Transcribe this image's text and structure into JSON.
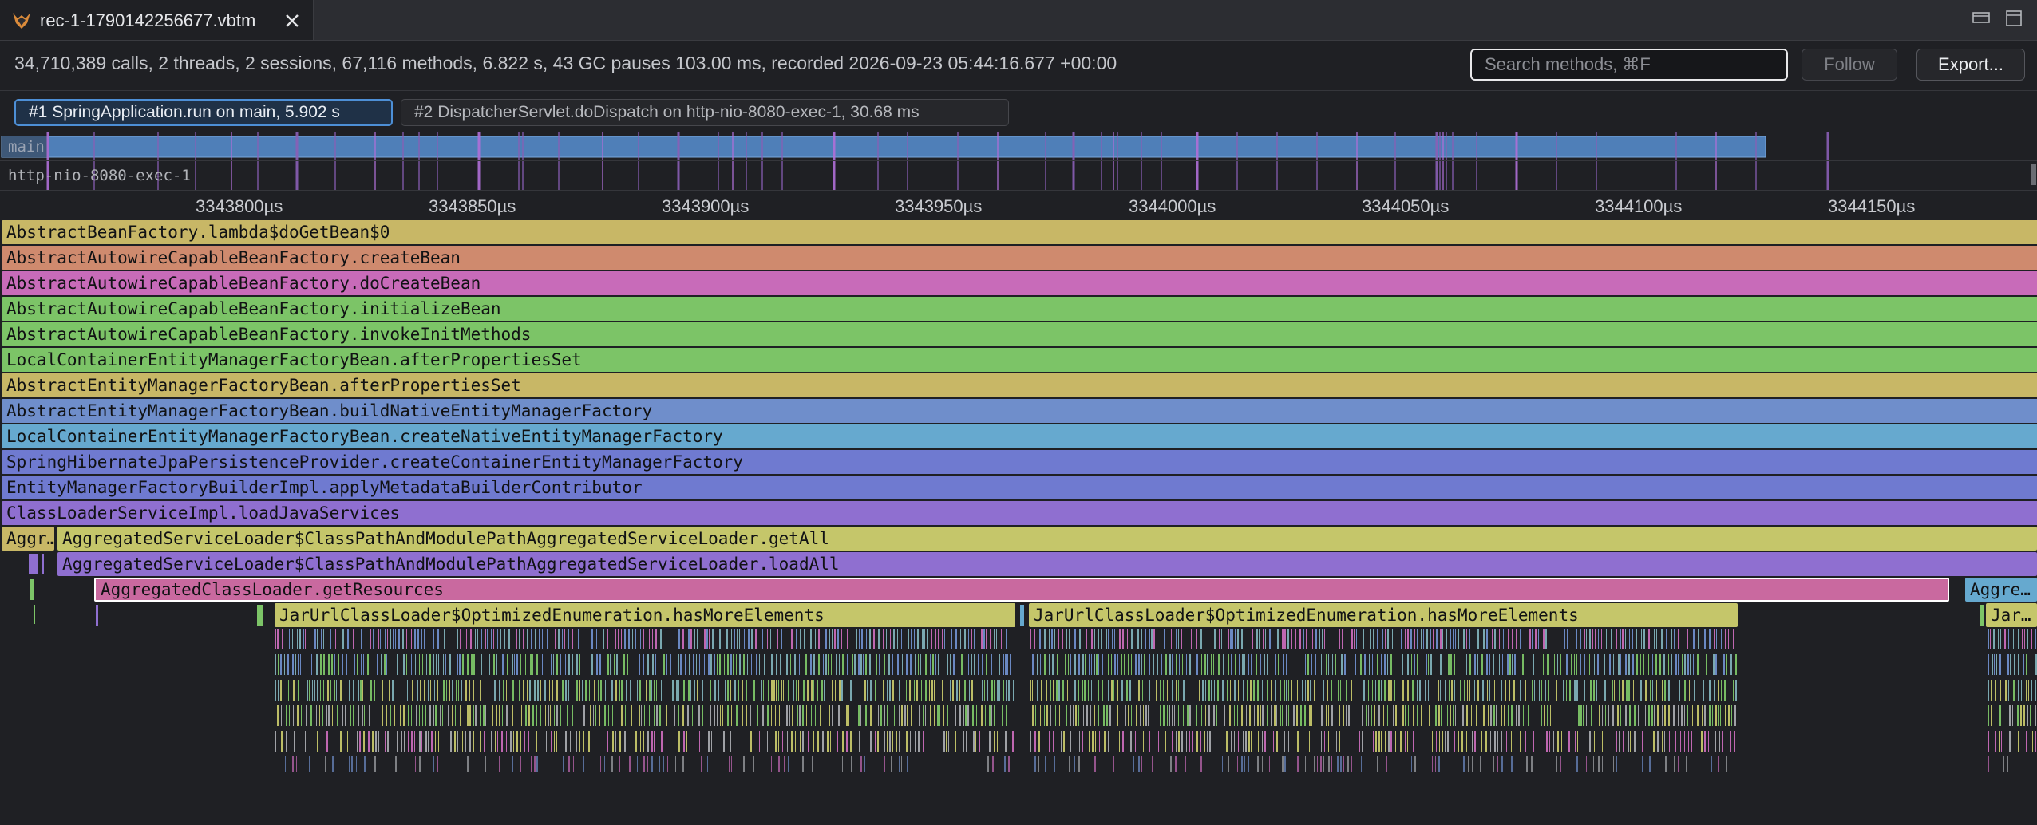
{
  "tab": {
    "title": "rec-1-1790142256677.vbtm",
    "close_icon": "close-icon",
    "logo_icon": "fox-logo-icon"
  },
  "window_controls": [
    "minimize-icon",
    "maximize-icon"
  ],
  "summary": {
    "text": "34,710,389 calls, 2 threads, 2 sessions, 67,116 methods, 6.822 s, 43 GC pauses 103.00 ms, recorded 2026-09-23 05:44:16.677 +00:00"
  },
  "search": {
    "placeholder": "Search methods, ⌘F",
    "value": ""
  },
  "buttons": {
    "follow": "Follow",
    "export": "Export..."
  },
  "sessions": [
    {
      "label": "#1 SpringApplication.run on main, 5.902 s",
      "active": true
    },
    {
      "label": "#2 DispatcherServlet.doDispatch on http-nio-8080-exec-1, 30.68 ms",
      "active": false
    }
  ],
  "threads": [
    {
      "name": "main"
    },
    {
      "name": "http-nio-8080-exec-1"
    }
  ],
  "axis_ticks": [
    "3343800µs",
    "3343850µs",
    "3343900µs",
    "3343950µs",
    "3344000µs",
    "3344050µs",
    "3344100µs",
    "3344150µs"
  ],
  "colors": {
    "yellow": "#c8b766",
    "orange": "#cf8a6e",
    "magenta": "#c86bb9",
    "green": "#7cc467",
    "blue": "#6f8ecb",
    "indigo": "#6f7ad0",
    "purple": "#8f6fd0",
    "pink": "#c9699f",
    "teal": "#66a9cf",
    "lime": "#c5c66a",
    "accent": "#4d8fd6"
  },
  "frames": [
    {
      "label": "AbstractBeanFactory.lambda$doGetBean$0",
      "color": "#c8b766"
    },
    {
      "label": "AbstractAutowireCapableBeanFactory.createBean",
      "color": "#cf8a6e"
    },
    {
      "label": "AbstractAutowireCapableBeanFactory.doCreateBean",
      "color": "#c86bb9"
    },
    {
      "label": "AbstractAutowireCapableBeanFactory.initializeBean",
      "color": "#7cc467"
    },
    {
      "label": "AbstractAutowireCapableBeanFactory.invokeInitMethods",
      "color": "#7cc467"
    },
    {
      "label": "LocalContainerEntityManagerFactoryBean.afterPropertiesSet",
      "color": "#7cc467"
    },
    {
      "label": "AbstractEntityManagerFactoryBean.afterPropertiesSet",
      "color": "#c8b766"
    },
    {
      "label": "AbstractEntityManagerFactoryBean.buildNativeEntityManagerFactory",
      "color": "#6f8ecb"
    },
    {
      "label": "LocalContainerEntityManagerFactoryBean.createNativeEntityManagerFactory",
      "color": "#66a9cf"
    },
    {
      "label": "SpringHibernateJpaPersistenceProvider.createContainerEntityManagerFactory",
      "color": "#6f7ad0"
    },
    {
      "label": "EntityManagerFactoryBuilderImpl.applyMetadataBuilderContributor",
      "color": "#6f7ad0"
    },
    {
      "label": "ClassLoaderServiceImpl.loadJavaServices",
      "color": "#8f6fd0"
    },
    {
      "label": "Aggr…",
      "color": "#c8b766"
    },
    {
      "label": "AggregatedServiceLoader$ClassPathAndModulePathAggregatedServiceLoader.getAll",
      "color": "#c5c66a"
    },
    {
      "label": "AggregatedServiceLoader$ClassPathAndModulePathAggregatedServiceLoader.loadAll",
      "color": "#8f6fd0"
    },
    {
      "label": "AggregatedClassLoader.getResources",
      "color": "#c9699f",
      "selected": true
    },
    {
      "label": "Aggre…",
      "color": "#66a9cf"
    },
    {
      "label": "JarUrlClassLoader$OptimizedEnumeration.hasMoreElements",
      "color": "#c5c66a"
    },
    {
      "label": "JarUrlClassLoader$OptimizedEnumeration.hasMoreElements",
      "color": "#c5c66a"
    },
    {
      "label": "Jar…",
      "color": "#c5c66a"
    }
  ]
}
